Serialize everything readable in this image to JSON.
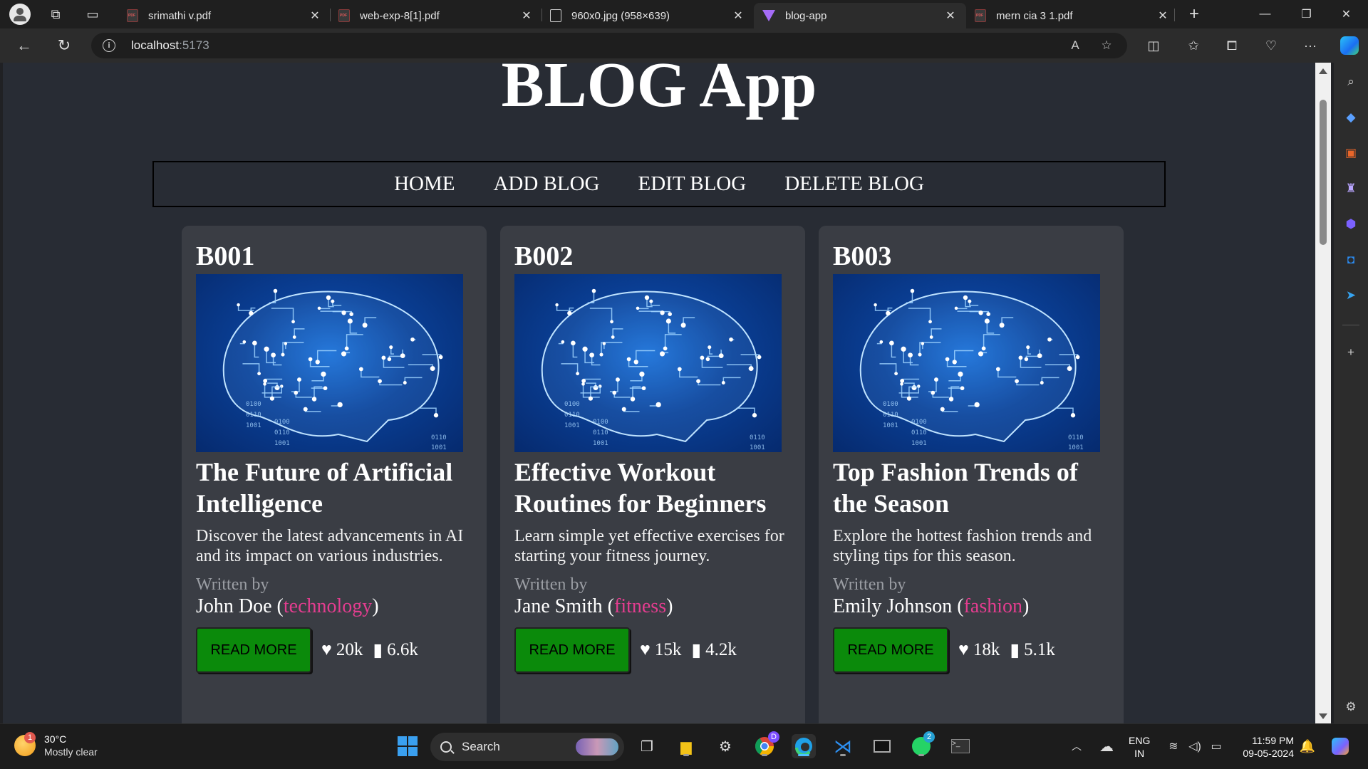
{
  "browser": {
    "tabs": [
      {
        "title": "srimathi v.pdf",
        "icon": "pdf-icon"
      },
      {
        "title": "web-exp-8[1].pdf",
        "icon": "pdf-icon"
      },
      {
        "title": "960x0.jpg (958×639)",
        "icon": "file-icon"
      },
      {
        "title": "blog-app",
        "icon": "vite-icon",
        "active": true
      },
      {
        "title": "mern cia 3 1.pdf",
        "icon": "pdf-icon"
      }
    ],
    "url_host": "localhost",
    "url_port": ":5173"
  },
  "page": {
    "title": "BLOG App",
    "nav": [
      "HOME",
      "ADD BLOG",
      "EDIT BLOG",
      "DELETE BLOG"
    ],
    "blogs": [
      {
        "id": "B001",
        "title": "The Future of Artificial Intelligence",
        "description": "Discover the latest advancements in AI and its impact on various industries.",
        "written_by": "Written by",
        "author": "John Doe",
        "category": "technology",
        "read_more": "READ MORE",
        "likes": "20k",
        "comments": "6.6k"
      },
      {
        "id": "B002",
        "title": "Effective Workout Routines for Beginners",
        "description": "Learn simple yet effective exercises for starting your fitness journey.",
        "written_by": "Written by",
        "author": "Jane Smith",
        "category": "fitness",
        "read_more": "READ MORE",
        "likes": "15k",
        "comments": "4.2k"
      },
      {
        "id": "B003",
        "title": "Top Fashion Trends of the Season",
        "description": "Explore the hottest fashion trends and styling tips for this season.",
        "written_by": "Written by",
        "author": "Emily Johnson",
        "category": "fashion",
        "read_more": "READ MORE",
        "likes": "18k",
        "comments": "5.1k"
      }
    ],
    "image_binary_labels": [
      "0100",
      "0110",
      "1001",
      "0100",
      "0110",
      "1001",
      "0110",
      "1001"
    ]
  },
  "taskbar": {
    "weather_temp": "30°C",
    "weather_desc": "Mostly clear",
    "weather_badge": "1",
    "search_label": "Search",
    "chrome_badge": "D",
    "whatsapp_badge": "2",
    "lang_top": "ENG",
    "lang_bottom": "IN",
    "time": "11:59 PM",
    "date": "09-05-2024"
  },
  "colors": {
    "page_bg": "#282c34",
    "card_bg": "#3a3d44",
    "category": "#e33d8f",
    "read_more_bg": "#0b8a0b"
  }
}
